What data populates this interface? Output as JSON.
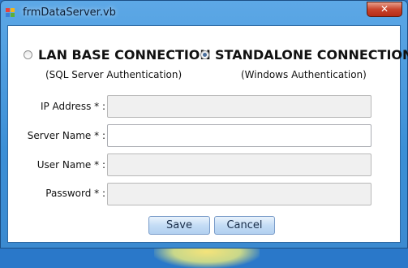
{
  "window": {
    "title": "frmDataServer.vb",
    "close_symbol": "✕",
    "app_icon": "form-icon",
    "accent": "#3c8fd6"
  },
  "connection": {
    "lan": {
      "label": "LAN BASE CONNECTION",
      "sublabel": "(SQL Server Authentication)",
      "selected": false
    },
    "standalone": {
      "label": "STANDALONE CONNECTION",
      "sublabel": "(Windows Authentication)",
      "selected": true
    }
  },
  "form": {
    "ip_label": "IP Address * :",
    "ip_value": "",
    "server_label": "Server Name * :",
    "server_value": "",
    "user_label": "User Name * :",
    "user_value": "",
    "password_label": "Password * :",
    "password_value": ""
  },
  "buttons": {
    "save": "Save",
    "cancel": "Cancel"
  }
}
